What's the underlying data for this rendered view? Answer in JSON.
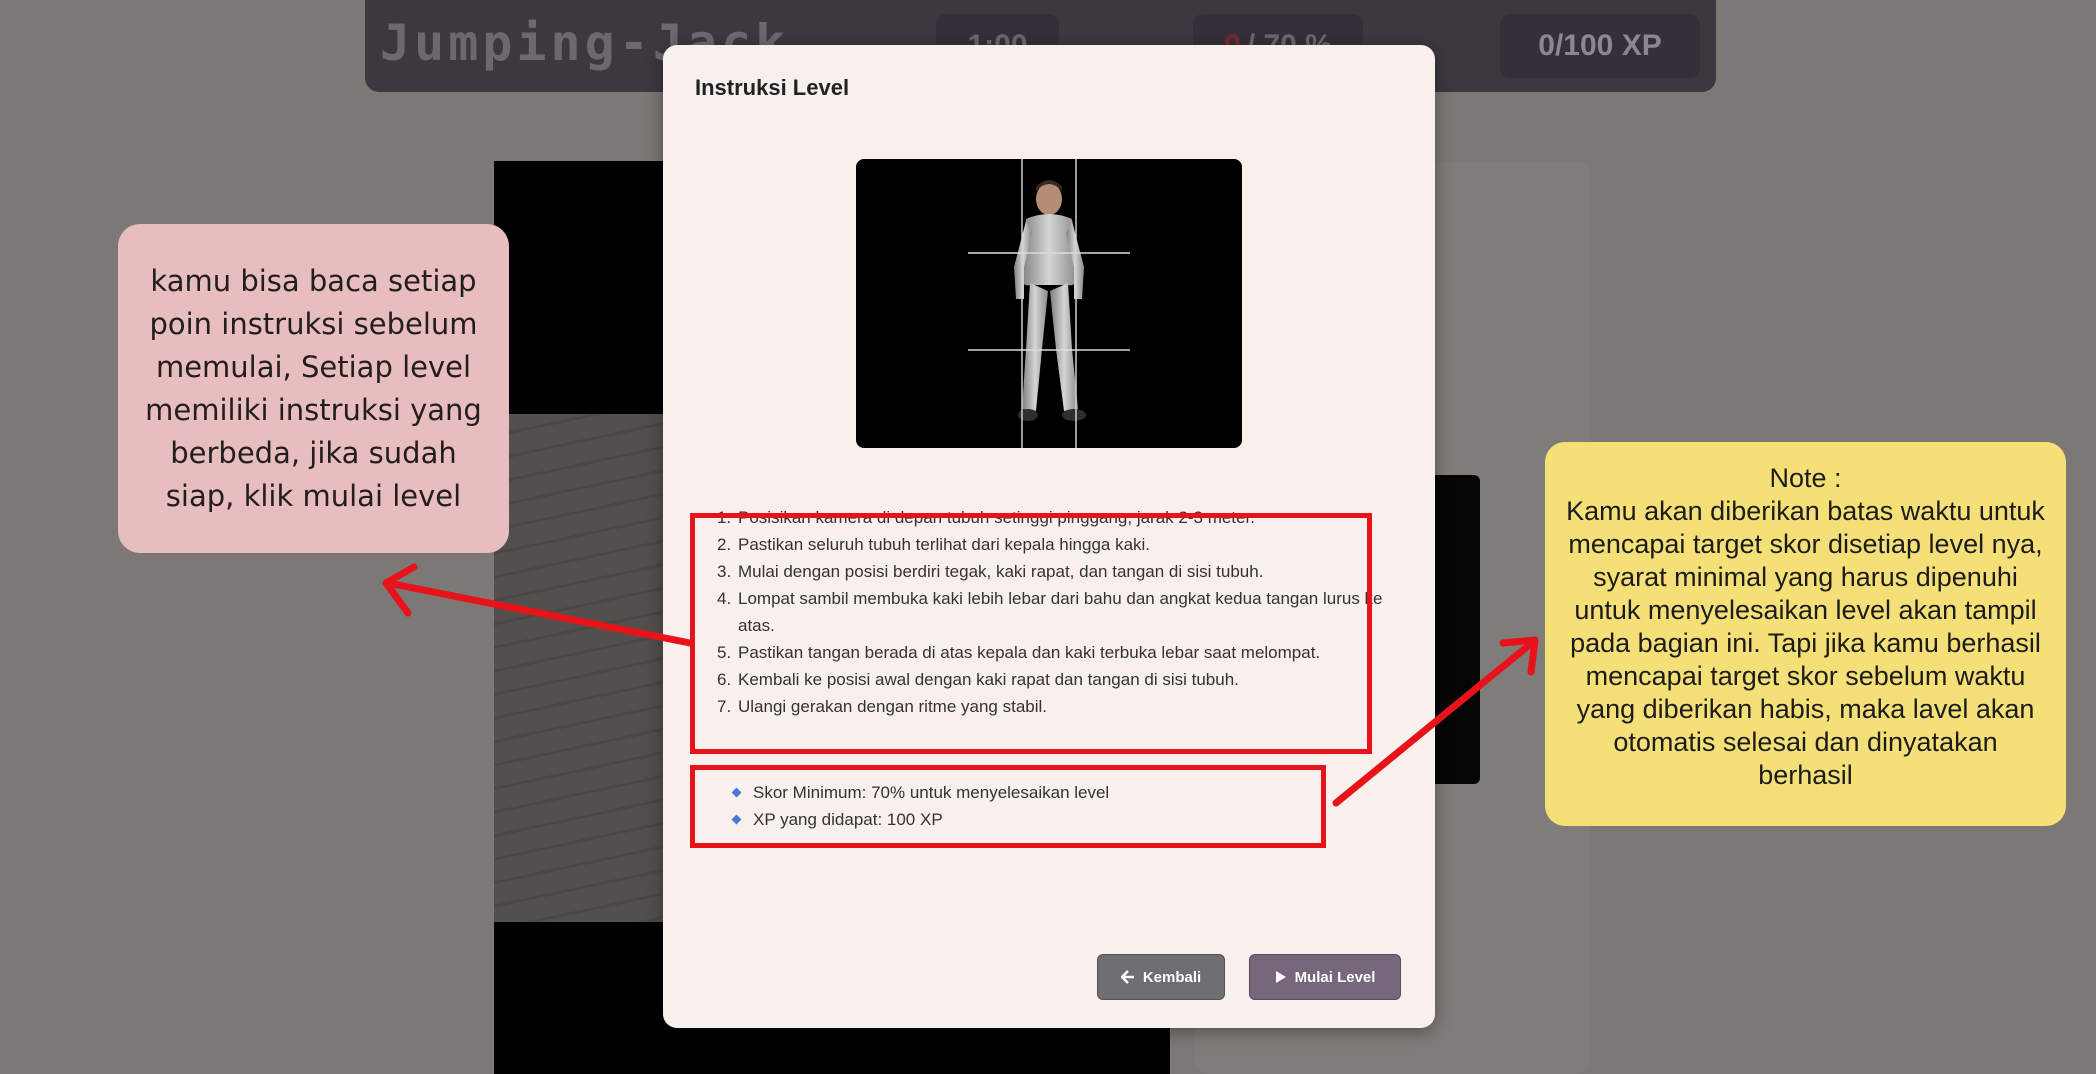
{
  "background": {
    "game_title": "Jumping-Jack",
    "timer": "1:00",
    "score_value": "0",
    "score_target": "/ 70 %",
    "xp": "0/100 XP"
  },
  "modal": {
    "title": "Instruksi Level",
    "instructions": [
      "Posisikan kamera di depan tubuh setinggi pinggang, jarak 2-3 meter.",
      "Pastikan seluruh tubuh terlihat dari kepala hingga kaki.",
      "Mulai dengan posisi berdiri tegak, kaki rapat, dan tangan di sisi tubuh.",
      "Lompat sambil membuka kaki lebih lebar dari bahu dan angkat kedua tangan lurus ke atas.",
      "Pastikan tangan berada di atas kepala dan kaki terbuka lebar saat melompat.",
      "Kembali ke posisi awal dengan kaki rapat dan tangan di sisi tubuh.",
      "Ulangi gerakan dengan ritme yang stabil."
    ],
    "requirements": [
      "Skor Minimum: 70% untuk menyelesaikan level",
      "XP yang didapat: 100 XP"
    ],
    "back_label": "Kembali",
    "start_label": "Mulai Level"
  },
  "annotations": {
    "pink_note": "kamu bisa baca setiap poin instruksi sebelum memulai, Setiap level memiliki instruksi yang berbeda, jika sudah siap, klik mulai level",
    "yellow_note_title": "Note :",
    "yellow_note_body": "Kamu akan diberikan batas waktu untuk mencapai target skor disetiap level nya, syarat minimal yang harus dipenuhi untuk menyelesaikan level akan tampil pada bagian ini. Tapi jika kamu berhasil mencapai target skor sebelum waktu yang diberikan habis, maka lavel akan otomatis selesai dan dinyatakan berhasil",
    "highlight_color": "#e8131a",
    "pink_color": "#e8bdbf",
    "yellow_color": "#f5e077"
  }
}
